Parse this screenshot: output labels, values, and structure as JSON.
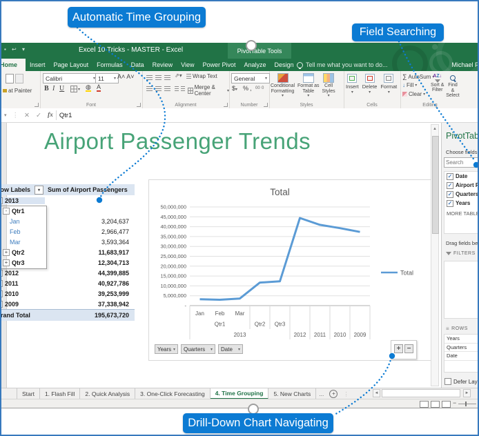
{
  "callouts": {
    "automatic_time_grouping": "Automatic Time Grouping",
    "field_searching": "Field Searching",
    "drill_down": "Drill-Down Chart Navigating"
  },
  "title_bar": {
    "app_title": "Excel 10 Tricks - MASTER - Excel",
    "context_group": "PivotTable Tools",
    "tell_me": "Tell me what you want to do...",
    "user_name": "Michael P"
  },
  "ribbon_tabs": [
    {
      "label": "Home",
      "active": true
    },
    {
      "label": "Insert"
    },
    {
      "label": "Page Layout"
    },
    {
      "label": "Formulas"
    },
    {
      "label": "Data"
    },
    {
      "label": "Review"
    },
    {
      "label": "View"
    },
    {
      "label": "Power Pivot"
    },
    {
      "label": "Analyze",
      "context": true
    },
    {
      "label": "Design",
      "context": true
    }
  ],
  "ribbon": {
    "clipboard": {
      "format_painter": "at Painter"
    },
    "font": {
      "font_name": "Calibri",
      "font_size": "11",
      "bold": "B",
      "italic": "I",
      "underline": "U",
      "group_label": "Font"
    },
    "alignment": {
      "wrap_text": "Wrap Text",
      "merge_center": "Merge & Center",
      "group_label": "Alignment"
    },
    "number": {
      "format": "General",
      "currency": "$",
      "percent": "%",
      "comma": ",",
      "group_label": "Number"
    },
    "styles": {
      "buttons": [
        [
          "Conditional",
          "Formatting"
        ],
        [
          "Format as",
          "Table"
        ],
        [
          "Cell",
          "Styles"
        ]
      ],
      "group_label": "Styles"
    },
    "cells": {
      "buttons": [
        "Insert",
        "Delete",
        "Format"
      ],
      "group_label": "Cells"
    },
    "editing": {
      "autosum": "AutoSum",
      "fill": "Fill",
      "clear": "Clear",
      "sort": [
        "Sort &",
        "Filter"
      ],
      "find": [
        "Find &",
        "Select"
      ],
      "group_label": "Editing"
    }
  },
  "formula_bar": {
    "value": "Qtr1",
    "fx_label": "fx",
    "cancel_label": "✕",
    "enter_label": "✓"
  },
  "worksheet": {
    "title": "Airport Passenger Trends"
  },
  "pivot_table": {
    "headers": [
      "Row Labels",
      "Sum of Airport Passengers"
    ],
    "rows": [
      {
        "label": "2013",
        "value": "",
        "level": 0,
        "expand": "minus",
        "bold": true,
        "selected": true
      },
      {
        "label": "Qtr1",
        "value": "",
        "level": 1,
        "expand": "minus",
        "bold": true
      },
      {
        "label": "Jan",
        "value": "3,204,637",
        "level": 2,
        "month": true
      },
      {
        "label": "Feb",
        "value": "2,966,477",
        "level": 2,
        "month": true
      },
      {
        "label": "Mar",
        "value": "3,593,364",
        "level": 2,
        "month": true
      },
      {
        "label": "Qtr2",
        "value": "11,683,917",
        "level": 1,
        "expand": "plus",
        "bold": true
      },
      {
        "label": "Qtr3",
        "value": "12,304,713",
        "level": 1,
        "expand": "plus",
        "bold": true
      },
      {
        "label": "2012",
        "value": "44,399,885",
        "level": 0,
        "expand": "plus",
        "bold": true
      },
      {
        "label": "2011",
        "value": "40,927,786",
        "level": 0,
        "expand": "plus",
        "bold": true
      },
      {
        "label": "2010",
        "value": "39,253,999",
        "level": 0,
        "expand": "plus",
        "bold": true
      },
      {
        "label": "2009",
        "value": "37,338,942",
        "level": 0,
        "expand": "plus",
        "bold": true
      },
      {
        "label": "Grand Total",
        "value": "195,673,720",
        "level": 0,
        "total": true,
        "bold": true
      }
    ]
  },
  "chart_data": {
    "type": "line",
    "title": "Total",
    "categories": [
      "Jan",
      "Feb",
      "Mar",
      "Qtr2",
      "Qtr3",
      "2012",
      "2011",
      "2010",
      "2009"
    ],
    "series": [
      {
        "name": "Total",
        "values": [
          3204637,
          2966477,
          3593364,
          11683917,
          12304713,
          44399885,
          40927786,
          39253999,
          37338942
        ]
      }
    ],
    "x_axis_levels": {
      "months": [
        {
          "label": "Jan",
          "start": 0,
          "end": 0
        },
        {
          "label": "Feb",
          "start": 1,
          "end": 1
        },
        {
          "label": "Mar",
          "start": 2,
          "end": 2
        }
      ],
      "quarters": [
        {
          "label": "Qtr1",
          "start": 0,
          "end": 2
        },
        {
          "label": "Qtr2",
          "start": 3,
          "end": 3
        },
        {
          "label": "Qtr3",
          "start": 4,
          "end": 4
        }
      ],
      "years": [
        {
          "label": "2013",
          "start": 0,
          "end": 4
        },
        {
          "label": "2012",
          "start": 5,
          "end": 5
        },
        {
          "label": "2011",
          "start": 6,
          "end": 6
        },
        {
          "label": "2010",
          "start": 7,
          "end": 7
        },
        {
          "label": "2009",
          "start": 8,
          "end": 8
        }
      ]
    },
    "ylim": [
      0,
      50000000
    ],
    "ytick_step": 5000000,
    "zero_label": "-",
    "grid": true,
    "legend": {
      "entries": [
        "Total"
      ],
      "position": "right"
    },
    "field_buttons": [
      "Years",
      "Quarters",
      "Date"
    ]
  },
  "fields_pane": {
    "title": "PivotTable",
    "choose_label": "Choose fields to a",
    "search_placeholder": "Search",
    "fields": [
      {
        "label": "Date",
        "checked": true
      },
      {
        "label": "Airport Passe",
        "checked": true
      },
      {
        "label": "Quarters",
        "checked": true
      },
      {
        "label": "Years",
        "checked": true
      }
    ],
    "more_tables": "MORE TABLES...",
    "drag_label": "Drag fields betw",
    "filters_label": "FILTERS",
    "rows_label": "ROWS",
    "row_items": [
      "Years",
      "Quarters",
      "Date"
    ],
    "defer_label": "Defer Layout"
  },
  "sheet_tabs": {
    "tabs": [
      "Start",
      "1. Flash Fill",
      "2. Quick Analysis",
      "3. One-Click Forecasting",
      "4. Time Grouping",
      "5. New Charts"
    ],
    "active": "4. Time Grouping",
    "overflow": "..."
  },
  "colors": {
    "callout_blue": "#0c7bd3",
    "excel_green": "#217346",
    "chart_line": "#5b9bd5",
    "worksheet_title_green": "#47a377",
    "header_fill": "#dbe5f1"
  }
}
